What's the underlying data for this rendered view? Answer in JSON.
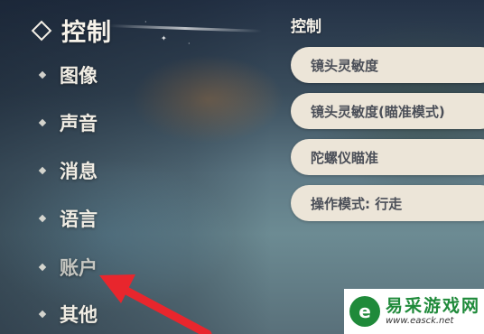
{
  "sidebar": {
    "header": "控制",
    "items": [
      {
        "label": "图像"
      },
      {
        "label": "声音"
      },
      {
        "label": "消息"
      },
      {
        "label": "语言"
      },
      {
        "label": "账户"
      },
      {
        "label": "其他"
      }
    ]
  },
  "main": {
    "section_title": "控制",
    "settings": [
      {
        "label": "镜头灵敏度"
      },
      {
        "label": "镜头灵敏度(瞄准模式)"
      },
      {
        "label": "陀螺仪瞄准"
      },
      {
        "label": "操作模式: 行走"
      }
    ]
  },
  "watermark": {
    "title": "易采游戏网",
    "url": "www.easck.net"
  },
  "colors": {
    "highlight_arrow": "#e8262d",
    "watermark_green": "#1f8a3a",
    "setting_bg": "#ece5d8"
  }
}
